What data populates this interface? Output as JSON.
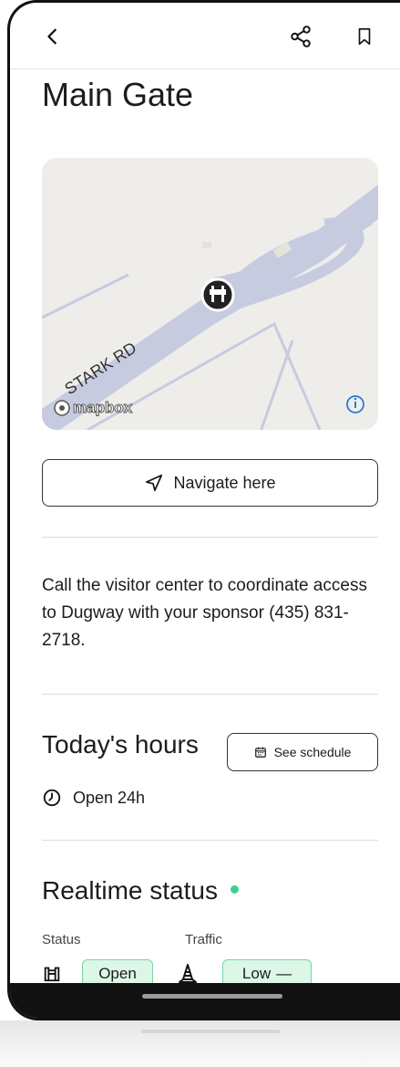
{
  "header": {
    "back_icon": "chevron-left-icon",
    "share_icon": "share-icon",
    "bookmark_icon": "bookmark-icon"
  },
  "title": "Main Gate",
  "map": {
    "road_label": "STARK RD",
    "attribution": "mapbox",
    "poi_icon": "road-barrier-icon",
    "info_icon": "info-icon"
  },
  "navigate": {
    "label": "Navigate here",
    "icon": "navigation-arrow-icon"
  },
  "description": "Call the visitor center to coordinate access to Dugway with your sponsor (435) 831-2718.",
  "hours": {
    "title": "Today's hours",
    "schedule_button": "See schedule",
    "status_text": "Open 24h",
    "clock_icon": "clock-icon",
    "calendar_icon": "calendar-icon"
  },
  "realtime": {
    "title": "Realtime status",
    "status_label": "Status",
    "status_value": "Open",
    "traffic_label": "Traffic",
    "traffic_value": "Low",
    "traffic_indicator": "—",
    "gate_icon": "gate-icon",
    "traffic_icon": "traffic-cone-icon",
    "dot_color": "#3ccf8e"
  }
}
